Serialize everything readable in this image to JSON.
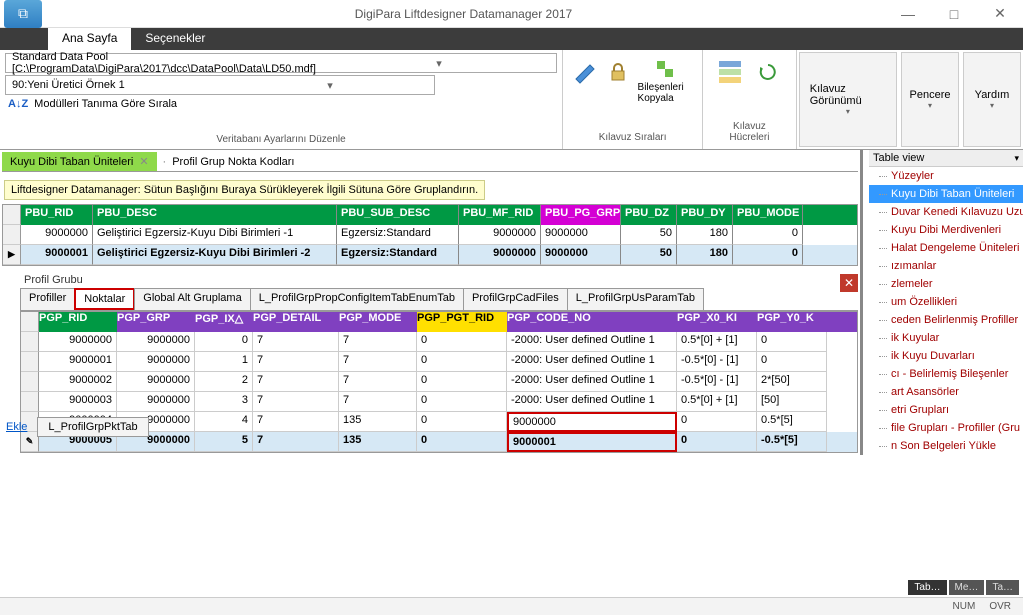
{
  "title": "DigiPara Liftdesigner Datamanager 2017",
  "win_controls": {
    "min": "—",
    "max": "□",
    "close": "✕"
  },
  "ribbon_tabs": {
    "home": "Ana Sayfa",
    "options": "Seçenekler"
  },
  "datapool": "Standard Data Pool [C:\\ProgramData\\DigiPara\\2017\\dcc\\DataPool\\Data\\LD50.mdf]",
  "manufacturer": "90:Yeni Üretici Örnek 1",
  "sort_label": "Modülleri Tanıma Göre Sırala",
  "db_settings": "Veritabanı Ayarlarını Düzenle",
  "ribbon": {
    "guide_rows": "Kılavuz Sıraları",
    "copy_components": "Bileşenleri Kopyala",
    "guide_cells": "Kılavuz Hücreleri",
    "guide_view": "Kılavuz Görünümü",
    "window": "Pencere",
    "help": "Yardım"
  },
  "tabchip": "Kuyu Dibi Taban Üniteleri",
  "breadcrumb2": "Profil Grup Nokta Kodları",
  "group_hint": "Liftdesigner Datamanager: Sütun Başlığını Buraya Sürükleyerek İlgili Sütuna Göre Gruplandırın.",
  "grid1": {
    "headers": [
      "PBU_RID",
      "PBU_DESC",
      "PBU_SUB_DESC",
      "PBU_MF_RID",
      "PBU_PG_GRP",
      "PBU_DZ",
      "PBU_DY",
      "PBU_MODE"
    ],
    "rows": [
      {
        "rid": "9000000",
        "desc": "Geliştirici Egzersiz-Kuyu Dibi Birimleri -1",
        "sub": "Egzersiz:Standard",
        "mf": "9000000",
        "pg": "9000000",
        "dz": "50",
        "dy": "180",
        "mode": "0"
      },
      {
        "rid": "9000001",
        "desc": "Geliştirici Egzersiz-Kuyu Dibi Birimleri -2",
        "sub": "Egzersiz:Standard",
        "mf": "9000000",
        "pg": "9000000",
        "dz": "50",
        "dy": "180",
        "mode": "0"
      }
    ]
  },
  "profile_section": "Profil Grubu",
  "inner_tabs": [
    "Profiller",
    "Noktalar",
    "Global Alt Gruplama",
    "L_ProfilGrpPropConfigItemTabEnumTab",
    "ProfilGrpCadFiles",
    "L_ProfilGrpUsParamTab"
  ],
  "grid2": {
    "headers": [
      "PGP_RID",
      "PGP_GRP",
      "PGP_IX△",
      "PGP_DETAIL",
      "PGP_MODE",
      "PGP_PGT_RID",
      "PGP_CODE_NO",
      "PGP_X0_KI",
      "PGP_Y0_K"
    ],
    "rows": [
      {
        "rid": "9000000",
        "grp": "9000000",
        "ix": "0",
        "det": "7",
        "mode": "7",
        "pgt": "0",
        "code": "-2000: User defined Outline 1",
        "x0": "0.5*[0] + [1]",
        "y0": "0"
      },
      {
        "rid": "9000001",
        "grp": "9000000",
        "ix": "1",
        "det": "7",
        "mode": "7",
        "pgt": "0",
        "code": "-2000: User defined Outline 1",
        "x0": "-0.5*[0] - [1]",
        "y0": "0"
      },
      {
        "rid": "9000002",
        "grp": "9000000",
        "ix": "2",
        "det": "7",
        "mode": "7",
        "pgt": "0",
        "code": "-2000: User defined Outline 1",
        "x0": "-0.5*[0] - [1]",
        "y0": "2*[50]"
      },
      {
        "rid": "9000003",
        "grp": "9000000",
        "ix": "3",
        "det": "7",
        "mode": "7",
        "pgt": "0",
        "code": "-2000: User defined Outline 1",
        "x0": "0.5*[0] + [1]",
        "y0": "[50]"
      },
      {
        "rid": "9000004",
        "grp": "9000000",
        "ix": "4",
        "det": "7",
        "mode": "135",
        "pgt": "0",
        "code": "9000000",
        "x0": "0",
        "y0": "0.5*[5]"
      },
      {
        "rid": "9000005",
        "grp": "9000000",
        "ix": "5",
        "det": "7",
        "mode": "135",
        "pgt": "0",
        "code": "9000001",
        "x0": "0",
        "y0": "-0.5*[5]"
      }
    ]
  },
  "footer": {
    "add": "Ekle",
    "tabname": "L_ProfilGrpPktTab"
  },
  "tree": {
    "title": "Table view",
    "items": [
      "Yüzeyler",
      "Kuyu Dibi Taban Üniteleri",
      "Duvar Kenedi Kılavuzu Uzunlu",
      "Kuyu Dibi Merdivenleri",
      "Halat Dengeleme Üniteleri",
      "ızımanlar",
      "zlemeler",
      "um Özellikleri",
      "ceden Belirlenmiş Profiller",
      "ik Kuyular",
      "ik Kuyu Duvarları",
      "cı - Belirlemiş Bileşenler",
      "art Asansörler",
      "etri Grupları",
      "file Grupları - Profiller (Gru",
      "n Son Belgeleri Yükle"
    ]
  },
  "mini_tabs": [
    "Tab…",
    "Me…",
    "Ta…"
  ],
  "status": {
    "num": "NUM",
    "ovr": "OVR"
  }
}
